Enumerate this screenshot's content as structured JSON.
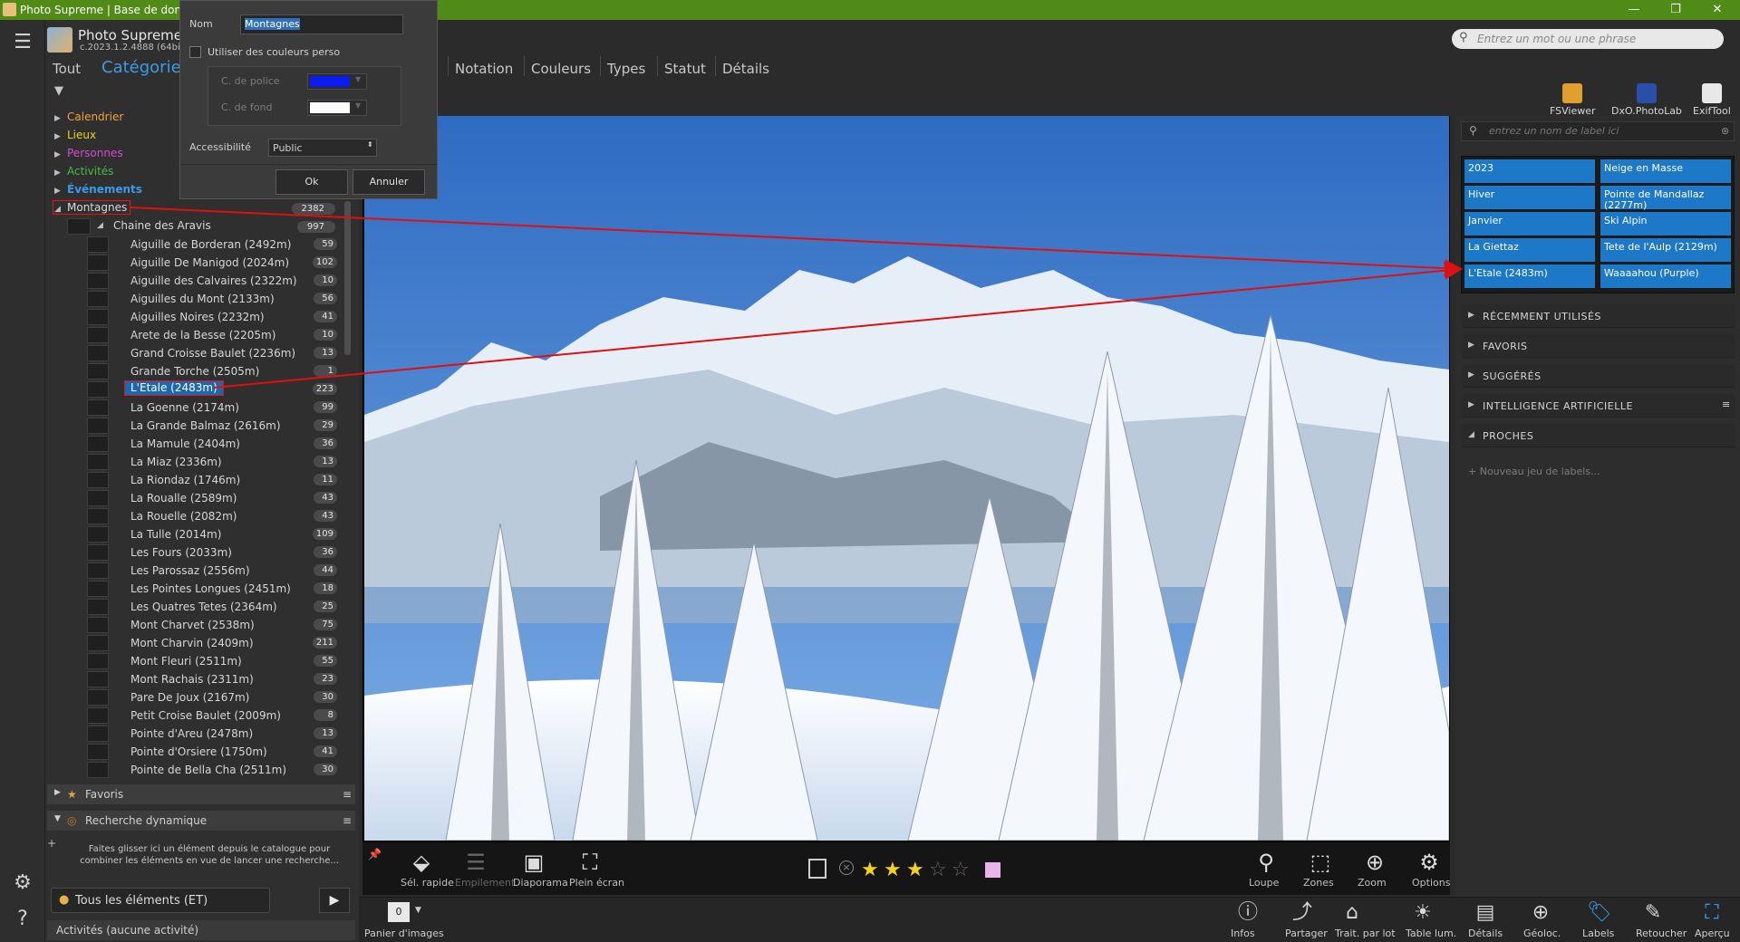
{
  "window": {
    "title": "Photo Supreme | Base de donnée",
    "controls": [
      "—",
      "❐",
      "✕"
    ]
  },
  "app": {
    "name": "Photo Supreme",
    "version": "c.2023.1.2.4888 (64bit)"
  },
  "left_tabs": {
    "all": "Tout",
    "categories": "Catégories"
  },
  "top_categories": [
    {
      "label": "Calendrier",
      "color": "#f0a23a"
    },
    {
      "label": "Lieux",
      "color": "#e8d320"
    },
    {
      "label": "Personnes",
      "color": "#d64ad6"
    },
    {
      "label": "Activités",
      "color": "#3fbf3f"
    },
    {
      "label": "Événements",
      "color": "#3a9be6"
    }
  ],
  "tree_parent": {
    "label": "Montagnes",
    "count": "2382"
  },
  "tree_group": {
    "label": "Chaine des Aravis",
    "count": "997"
  },
  "tree_items": [
    {
      "label": "Aiguille de Borderan (2492m)",
      "count": "59"
    },
    {
      "label": "Aiguille De Manigod (2024m)",
      "count": "102"
    },
    {
      "label": "Aiguille des Calvaires (2322m)",
      "count": "10"
    },
    {
      "label": "Aiguilles du Mont (2133m)",
      "count": "56"
    },
    {
      "label": "Aiguilles Noires (2232m)",
      "count": "41"
    },
    {
      "label": "Arete de la Besse (2205m)",
      "count": "10"
    },
    {
      "label": "Grand Croisse Baulet (2236m)",
      "count": "13"
    },
    {
      "label": "Grande Torche (2505m)",
      "count": "1"
    },
    {
      "label": "L'Etale (2483m)",
      "count": "223",
      "selected": true
    },
    {
      "label": "La Goenne (2174m)",
      "count": "99"
    },
    {
      "label": "La Grande Balmaz (2616m)",
      "count": "29"
    },
    {
      "label": "La Mamule (2404m)",
      "count": "36"
    },
    {
      "label": "La Miaz (2336m)",
      "count": "13"
    },
    {
      "label": "La Riondaz (1746m)",
      "count": "11"
    },
    {
      "label": "La Roualle (2589m)",
      "count": "43"
    },
    {
      "label": "La Rouelle (2082m)",
      "count": "43"
    },
    {
      "label": "La Tulle (2014m)",
      "count": "109"
    },
    {
      "label": "Les Fours (2033m)",
      "count": "36"
    },
    {
      "label": "Les Parossaz (2556m)",
      "count": "44"
    },
    {
      "label": "Les Pointes Longues (2451m)",
      "count": "18"
    },
    {
      "label": "Les Quatres Tetes (2364m)",
      "count": "25"
    },
    {
      "label": "Mont Charvet (2538m)",
      "count": "75"
    },
    {
      "label": "Mont Charvin (2409m)",
      "count": "211"
    },
    {
      "label": "Mont Fleuri (2511m)",
      "count": "55"
    },
    {
      "label": "Mont Rachais (2311m)",
      "count": "23"
    },
    {
      "label": "Pare De Joux (2167m)",
      "count": "30"
    },
    {
      "label": "Petit Croise Baulet (2009m)",
      "count": "8"
    },
    {
      "label": "Pointe d'Areu (2478m)",
      "count": "13"
    },
    {
      "label": "Pointe d'Orsiere (1750m)",
      "count": "41"
    },
    {
      "label": "Pointe de Bella Cha (2511m)",
      "count": "30"
    }
  ],
  "left_sections": {
    "favorites": "Favoris",
    "dynamic_search": "Recherche dynamique",
    "dynamic_hint": "Faites glisser ici un élément depuis le catalogue pour combiner les éléments en vue de lancer une recherche...",
    "all_elements": "Tous les éléments (ET)",
    "activities": "Activités (aucune activité)"
  },
  "dialog": {
    "name_label": "Nom",
    "name_value": "Montagnes",
    "custom_colors_label": "Utiliser des couleurs perso",
    "font_color_label": "C. de police",
    "font_color": "#0b1cf0",
    "bg_color_label": "C. de fond",
    "bg_color": "#ffffff",
    "accessibility_label": "Accessibilité",
    "accessibility_value": "Public",
    "ok": "Ok",
    "cancel": "Annuler"
  },
  "top_tabs": [
    "Notation",
    "Couleurs",
    "Types",
    "Statut",
    "Détails"
  ],
  "search": {
    "placeholder": "Entrez un mot ou une phrase"
  },
  "external_apps": [
    {
      "label": "FSViewer",
      "icon": "fsviewer-icon",
      "color": "#e0a030"
    },
    {
      "label": "DxO.PhotoLab",
      "icon": "dxo-icon",
      "color": "#2a4fa8"
    },
    {
      "label": "ExifTool",
      "icon": "exiftool-icon",
      "color": "#e8e8e8"
    }
  ],
  "viewer_tools_left": [
    {
      "label": "Sél. rapide",
      "icon": "quick-select-icon"
    },
    {
      "label": "Empilement",
      "icon": "stack-icon"
    },
    {
      "label": "Diaporama",
      "icon": "slideshow-icon"
    },
    {
      "label": "Plein écran",
      "icon": "fullscreen-icon"
    }
  ],
  "rating": {
    "value": 3,
    "max": 5,
    "color_label": "#e9b4ea"
  },
  "viewer_tools_right": [
    {
      "label": "Loupe",
      "icon": "loupe-icon"
    },
    {
      "label": "Zones",
      "icon": "zones-icon"
    },
    {
      "label": "Zoom",
      "icon": "zoom-icon"
    },
    {
      "label": "Options",
      "icon": "options-gear-icon"
    }
  ],
  "basket": {
    "label": "Panier d'images",
    "count": "0"
  },
  "bottom_tools": [
    {
      "label": "Infos",
      "icon": "info-icon"
    },
    {
      "label": "Partager",
      "icon": "share-icon"
    },
    {
      "label": "Trait. par lot",
      "icon": "batch-icon"
    },
    {
      "label": "Table lum.",
      "icon": "lighttable-icon"
    },
    {
      "label": "Détails",
      "icon": "details-icon"
    },
    {
      "label": "Géoloc.",
      "icon": "geoloc-icon"
    },
    {
      "label": "Labels",
      "icon": "labels-icon"
    },
    {
      "label": "Retoucher",
      "icon": "retouch-icon"
    },
    {
      "label": "Aperçu",
      "icon": "preview-icon"
    }
  ],
  "label_search": {
    "placeholder": "entrez un nom de label ici"
  },
  "assigned_labels": [
    "2023",
    "Neige en Masse",
    "Hiver",
    "Pointe de Mandallaz (2277m)",
    "Janvier",
    "Ski Alpin",
    "La Giettaz",
    "Tete de l'Aulp (2129m)",
    "L'Etale (2483m)",
    "Waaaahou (Purple)"
  ],
  "right_sections": [
    {
      "label": "RÉCEMMENT UTILISÉS",
      "expanded": false
    },
    {
      "label": "FAVORIS",
      "expanded": false
    },
    {
      "label": "SUGGÉRÉS",
      "expanded": false
    },
    {
      "label": "INTELLIGENCE ARTIFICIELLE",
      "expanded": false
    },
    {
      "label": "PROCHES",
      "expanded": true
    }
  ],
  "new_label_set": "Nouveau jeu de labels...",
  "annotation_color": "#e01010"
}
